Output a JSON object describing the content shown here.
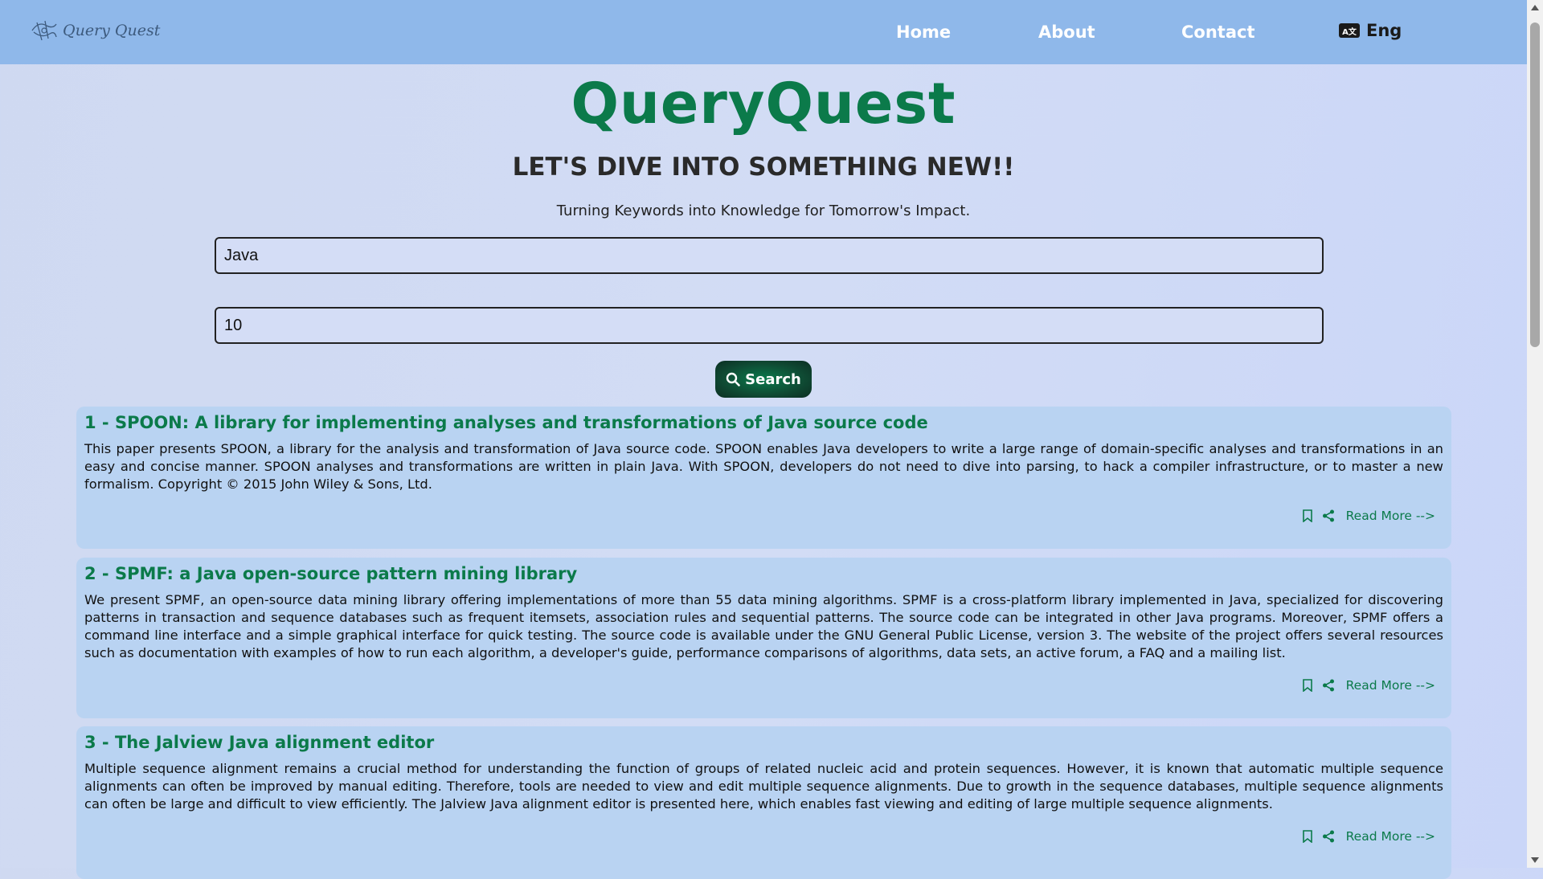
{
  "brand": {
    "name": "Query Quest"
  },
  "nav": {
    "items": [
      "Home",
      "About",
      "Contact"
    ],
    "language": "Eng"
  },
  "hero": {
    "title": "QueryQuest",
    "subtitle": "LET'S DIVE INTO SOMETHING NEW!!",
    "tagline": "Turning Keywords into Knowledge for Tomorrow's Impact."
  },
  "search": {
    "keyword_value": "Java",
    "count_value": "10",
    "button_label": "Search"
  },
  "results": [
    {
      "title": "1 - SPOON: A library for implementing analyses and transformations of Java source code",
      "abstract": "This paper presents SPOON, a library for the analysis and transformation of Java source code. SPOON enables Java developers to write a large range of domain-specific analyses and transformations in an easy and concise manner. SPOON analyses and transformations are written in plain Java. With SPOON, developers do not need to dive into parsing, to hack a compiler infrastructure, or to master a new formalism. Copyright © 2015 John Wiley & Sons, Ltd.",
      "read_more": "Read More -->"
    },
    {
      "title": "2 - SPMF: a Java open-source pattern mining library",
      "abstract": "We present SPMF, an open-source data mining library offering implementations of more than 55 data mining algorithms. SPMF is a cross-platform library implemented in Java, specialized for discovering patterns in transaction and sequence databases such as frequent itemsets, association rules and sequential patterns. The source code can be integrated in other Java programs. Moreover, SPMF offers a command line interface and a simple graphical interface for quick testing. The source code is available under the GNU General Public License, version 3. The website of the project offers several resources such as documentation with examples of how to run each algorithm, a developer's guide, performance comparisons of algorithms, data sets, an active forum, a FAQ and a mailing list.",
      "read_more": "Read More -->"
    },
    {
      "title": "3 - The Jalview Java alignment editor",
      "abstract": "Multiple sequence alignment remains a crucial method for understanding the function of groups of related nucleic acid and protein sequences. However, it is known that automatic multiple sequence alignments can often be improved by manual editing. Therefore, tools are needed to view and edit multiple sequence alignments. Due to growth in the sequence databases, multiple sequence alignments can often be large and difficult to view efficiently. The Jalview Java alignment editor is presented here, which enables fast viewing and editing of large multiple sequence alignments.",
      "read_more": "Read More -->"
    }
  ],
  "colors": {
    "accent": "#0b7a4a",
    "navbar": "#8fb8ea",
    "card": "#b9d3f2"
  }
}
